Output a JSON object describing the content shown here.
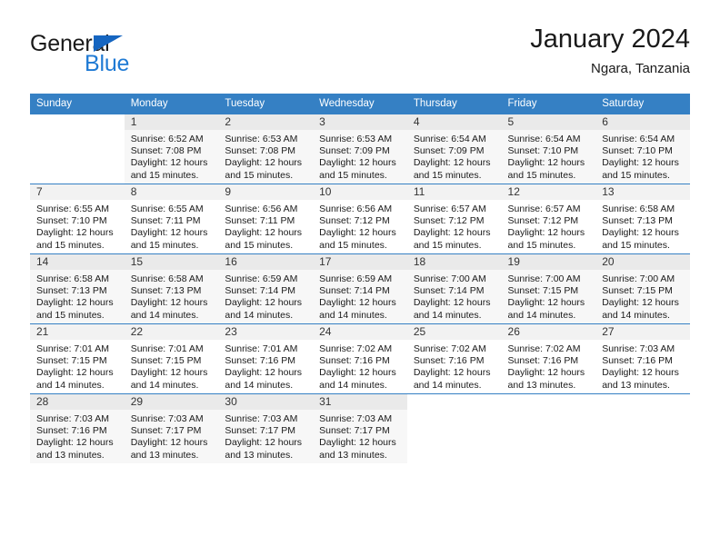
{
  "brand": {
    "name_part1": "General",
    "name_part2": "Blue",
    "accent_color": "#1f7ad4",
    "flag_color": "#1565c0"
  },
  "header": {
    "title": "January 2024",
    "location": "Ngara, Tanzania",
    "header_bg_color": "#3580c4",
    "header_text_color": "#ffffff"
  },
  "weekdays": [
    "Sunday",
    "Monday",
    "Tuesday",
    "Wednesday",
    "Thursday",
    "Friday",
    "Saturday"
  ],
  "weeks": [
    [
      {
        "day": "",
        "sunrise": "",
        "sunset": "",
        "daylight_line1": "",
        "daylight_line2": ""
      },
      {
        "day": "1",
        "sunrise": "Sunrise: 6:52 AM",
        "sunset": "Sunset: 7:08 PM",
        "daylight_line1": "Daylight: 12 hours",
        "daylight_line2": "and 15 minutes."
      },
      {
        "day": "2",
        "sunrise": "Sunrise: 6:53 AM",
        "sunset": "Sunset: 7:08 PM",
        "daylight_line1": "Daylight: 12 hours",
        "daylight_line2": "and 15 minutes."
      },
      {
        "day": "3",
        "sunrise": "Sunrise: 6:53 AM",
        "sunset": "Sunset: 7:09 PM",
        "daylight_line1": "Daylight: 12 hours",
        "daylight_line2": "and 15 minutes."
      },
      {
        "day": "4",
        "sunrise": "Sunrise: 6:54 AM",
        "sunset": "Sunset: 7:09 PM",
        "daylight_line1": "Daylight: 12 hours",
        "daylight_line2": "and 15 minutes."
      },
      {
        "day": "5",
        "sunrise": "Sunrise: 6:54 AM",
        "sunset": "Sunset: 7:10 PM",
        "daylight_line1": "Daylight: 12 hours",
        "daylight_line2": "and 15 minutes."
      },
      {
        "day": "6",
        "sunrise": "Sunrise: 6:54 AM",
        "sunset": "Sunset: 7:10 PM",
        "daylight_line1": "Daylight: 12 hours",
        "daylight_line2": "and 15 minutes."
      }
    ],
    [
      {
        "day": "7",
        "sunrise": "Sunrise: 6:55 AM",
        "sunset": "Sunset: 7:10 PM",
        "daylight_line1": "Daylight: 12 hours",
        "daylight_line2": "and 15 minutes."
      },
      {
        "day": "8",
        "sunrise": "Sunrise: 6:55 AM",
        "sunset": "Sunset: 7:11 PM",
        "daylight_line1": "Daylight: 12 hours",
        "daylight_line2": "and 15 minutes."
      },
      {
        "day": "9",
        "sunrise": "Sunrise: 6:56 AM",
        "sunset": "Sunset: 7:11 PM",
        "daylight_line1": "Daylight: 12 hours",
        "daylight_line2": "and 15 minutes."
      },
      {
        "day": "10",
        "sunrise": "Sunrise: 6:56 AM",
        "sunset": "Sunset: 7:12 PM",
        "daylight_line1": "Daylight: 12 hours",
        "daylight_line2": "and 15 minutes."
      },
      {
        "day": "11",
        "sunrise": "Sunrise: 6:57 AM",
        "sunset": "Sunset: 7:12 PM",
        "daylight_line1": "Daylight: 12 hours",
        "daylight_line2": "and 15 minutes."
      },
      {
        "day": "12",
        "sunrise": "Sunrise: 6:57 AM",
        "sunset": "Sunset: 7:12 PM",
        "daylight_line1": "Daylight: 12 hours",
        "daylight_line2": "and 15 minutes."
      },
      {
        "day": "13",
        "sunrise": "Sunrise: 6:58 AM",
        "sunset": "Sunset: 7:13 PM",
        "daylight_line1": "Daylight: 12 hours",
        "daylight_line2": "and 15 minutes."
      }
    ],
    [
      {
        "day": "14",
        "sunrise": "Sunrise: 6:58 AM",
        "sunset": "Sunset: 7:13 PM",
        "daylight_line1": "Daylight: 12 hours",
        "daylight_line2": "and 15 minutes."
      },
      {
        "day": "15",
        "sunrise": "Sunrise: 6:58 AM",
        "sunset": "Sunset: 7:13 PM",
        "daylight_line1": "Daylight: 12 hours",
        "daylight_line2": "and 14 minutes."
      },
      {
        "day": "16",
        "sunrise": "Sunrise: 6:59 AM",
        "sunset": "Sunset: 7:14 PM",
        "daylight_line1": "Daylight: 12 hours",
        "daylight_line2": "and 14 minutes."
      },
      {
        "day": "17",
        "sunrise": "Sunrise: 6:59 AM",
        "sunset": "Sunset: 7:14 PM",
        "daylight_line1": "Daylight: 12 hours",
        "daylight_line2": "and 14 minutes."
      },
      {
        "day": "18",
        "sunrise": "Sunrise: 7:00 AM",
        "sunset": "Sunset: 7:14 PM",
        "daylight_line1": "Daylight: 12 hours",
        "daylight_line2": "and 14 minutes."
      },
      {
        "day": "19",
        "sunrise": "Sunrise: 7:00 AM",
        "sunset": "Sunset: 7:15 PM",
        "daylight_line1": "Daylight: 12 hours",
        "daylight_line2": "and 14 minutes."
      },
      {
        "day": "20",
        "sunrise": "Sunrise: 7:00 AM",
        "sunset": "Sunset: 7:15 PM",
        "daylight_line1": "Daylight: 12 hours",
        "daylight_line2": "and 14 minutes."
      }
    ],
    [
      {
        "day": "21",
        "sunrise": "Sunrise: 7:01 AM",
        "sunset": "Sunset: 7:15 PM",
        "daylight_line1": "Daylight: 12 hours",
        "daylight_line2": "and 14 minutes."
      },
      {
        "day": "22",
        "sunrise": "Sunrise: 7:01 AM",
        "sunset": "Sunset: 7:15 PM",
        "daylight_line1": "Daylight: 12 hours",
        "daylight_line2": "and 14 minutes."
      },
      {
        "day": "23",
        "sunrise": "Sunrise: 7:01 AM",
        "sunset": "Sunset: 7:16 PM",
        "daylight_line1": "Daylight: 12 hours",
        "daylight_line2": "and 14 minutes."
      },
      {
        "day": "24",
        "sunrise": "Sunrise: 7:02 AM",
        "sunset": "Sunset: 7:16 PM",
        "daylight_line1": "Daylight: 12 hours",
        "daylight_line2": "and 14 minutes."
      },
      {
        "day": "25",
        "sunrise": "Sunrise: 7:02 AM",
        "sunset": "Sunset: 7:16 PM",
        "daylight_line1": "Daylight: 12 hours",
        "daylight_line2": "and 14 minutes."
      },
      {
        "day": "26",
        "sunrise": "Sunrise: 7:02 AM",
        "sunset": "Sunset: 7:16 PM",
        "daylight_line1": "Daylight: 12 hours",
        "daylight_line2": "and 13 minutes."
      },
      {
        "day": "27",
        "sunrise": "Sunrise: 7:03 AM",
        "sunset": "Sunset: 7:16 PM",
        "daylight_line1": "Daylight: 12 hours",
        "daylight_line2": "and 13 minutes."
      }
    ],
    [
      {
        "day": "28",
        "sunrise": "Sunrise: 7:03 AM",
        "sunset": "Sunset: 7:16 PM",
        "daylight_line1": "Daylight: 12 hours",
        "daylight_line2": "and 13 minutes."
      },
      {
        "day": "29",
        "sunrise": "Sunrise: 7:03 AM",
        "sunset": "Sunset: 7:17 PM",
        "daylight_line1": "Daylight: 12 hours",
        "daylight_line2": "and 13 minutes."
      },
      {
        "day": "30",
        "sunrise": "Sunrise: 7:03 AM",
        "sunset": "Sunset: 7:17 PM",
        "daylight_line1": "Daylight: 12 hours",
        "daylight_line2": "and 13 minutes."
      },
      {
        "day": "31",
        "sunrise": "Sunrise: 7:03 AM",
        "sunset": "Sunset: 7:17 PM",
        "daylight_line1": "Daylight: 12 hours",
        "daylight_line2": "and 13 minutes."
      },
      {
        "day": "",
        "sunrise": "",
        "sunset": "",
        "daylight_line1": "",
        "daylight_line2": ""
      },
      {
        "day": "",
        "sunrise": "",
        "sunset": "",
        "daylight_line1": "",
        "daylight_line2": ""
      },
      {
        "day": "",
        "sunrise": "",
        "sunset": "",
        "daylight_line1": "",
        "daylight_line2": ""
      }
    ]
  ]
}
